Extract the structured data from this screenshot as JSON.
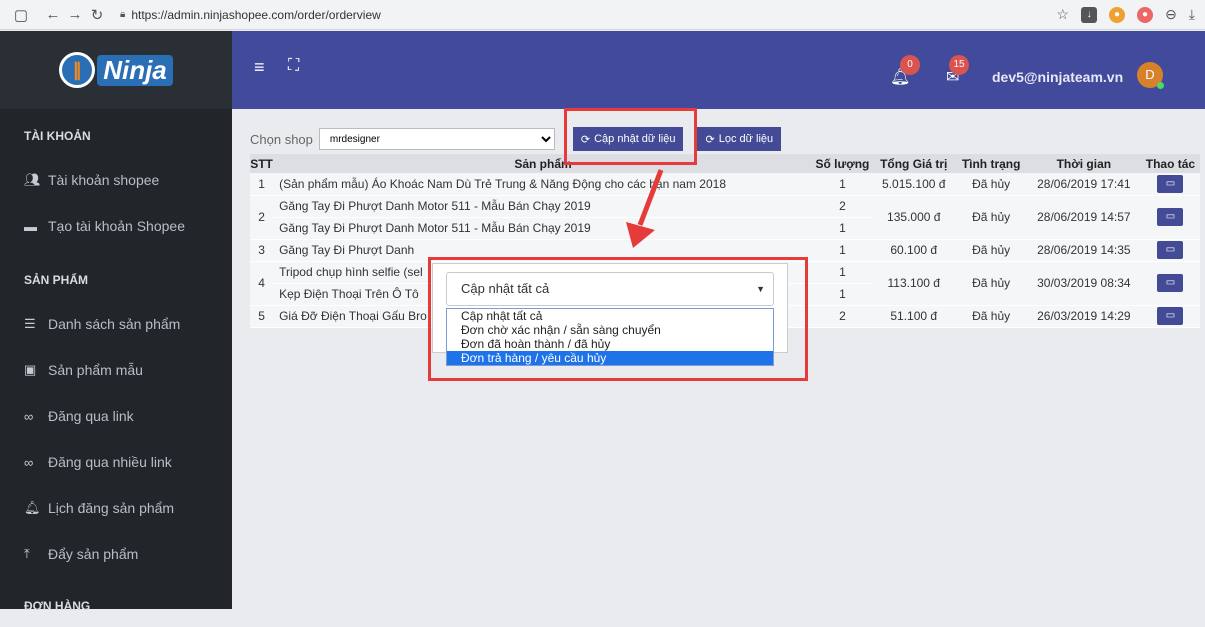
{
  "browser": {
    "url": "https://admin.ninjashopee.com/order/orderview"
  },
  "brand": {
    "logo_text": "Ninja"
  },
  "header": {
    "notif_count": "0",
    "msg_count": "15",
    "user_email": "dev5@ninjateam.vn",
    "avatar_letter": "D"
  },
  "sidebar": {
    "sections": [
      {
        "title": "TÀI KHOẢN",
        "items": [
          "Tài khoản shopee",
          "Tạo tài khoản Shopee"
        ]
      },
      {
        "title": "SẢN PHẨM",
        "items": [
          "Danh sách sản phẩm",
          "Sản phẩm mẫu",
          "Đăng qua link",
          "Đăng qua nhiều link",
          "Lịch đăng sản phẩm",
          "Đẩy sản phẩm"
        ]
      },
      {
        "title": "ĐƠN HÀNG",
        "items": []
      }
    ]
  },
  "toolbar": {
    "shop_label": "Chọn shop",
    "shop_value": "mrdesigner",
    "update_button": "Cập nhật dữ liệu",
    "filter_button": "Lọc dữ liệu"
  },
  "table": {
    "headers": [
      "STT",
      "Sản phẩm",
      "Số lượng",
      "Tổng Giá trị",
      "Tình trạng",
      "Thời gian",
      "Thao tác"
    ],
    "rows": [
      {
        "stt": "1",
        "products": [
          "(Sản phẩm mẫu) Áo Khoác Nam Dù Trẻ Trung & Năng Động cho các bạn nam 2018"
        ],
        "qty": [
          "1"
        ],
        "total": "5.015.100 đ",
        "status": "Đã hủy",
        "time": "28/06/2019 17:41"
      },
      {
        "stt": "2",
        "products": [
          "Găng Tay Đi Phượt Danh Motor 511 - Mẫu Bán Chạy 2019",
          "Găng Tay Đi Phượt Danh Motor 511 - Mẫu Bán Chạy 2019"
        ],
        "qty": [
          "2",
          "1"
        ],
        "total": "135.000 đ",
        "status": "Đã hủy",
        "time": "28/06/2019 14:57"
      },
      {
        "stt": "3",
        "products": [
          "Găng Tay Đi Phượt Danh"
        ],
        "qty": [
          "1"
        ],
        "total": "60.100 đ",
        "status": "Đã hủy",
        "time": "28/06/2019 14:35"
      },
      {
        "stt": "4",
        "products": [
          "Tripod chụp hình selfie (sel",
          "Kẹp Điện Thoại Trên Ô Tô"
        ],
        "qty": [
          "1",
          "1"
        ],
        "total": "113.100 đ",
        "status": "Đã hủy",
        "time": "30/03/2019 08:34"
      },
      {
        "stt": "5",
        "products": [
          "Giá Đỡ Điện Thoại Gấu Bro"
        ],
        "qty": [
          "2"
        ],
        "total": "51.100 đ",
        "status": "Đã hủy",
        "time": "26/03/2019 14:29"
      }
    ]
  },
  "update_dropdown": {
    "selected": "Cập nhật tất cả",
    "options": [
      "Cập nhật tất cả",
      "Đơn chờ xác nhận / sẵn sàng chuyển",
      "Đơn đã hoàn thành / đã hủy",
      "Đơn trả hàng / yêu cầu hủy"
    ],
    "highlighted_index": 3
  },
  "colors": {
    "accent": "#434a96",
    "sidebar": "#22262b",
    "annotation": "#e53b3b",
    "option_highlight": "#1e73e8"
  }
}
